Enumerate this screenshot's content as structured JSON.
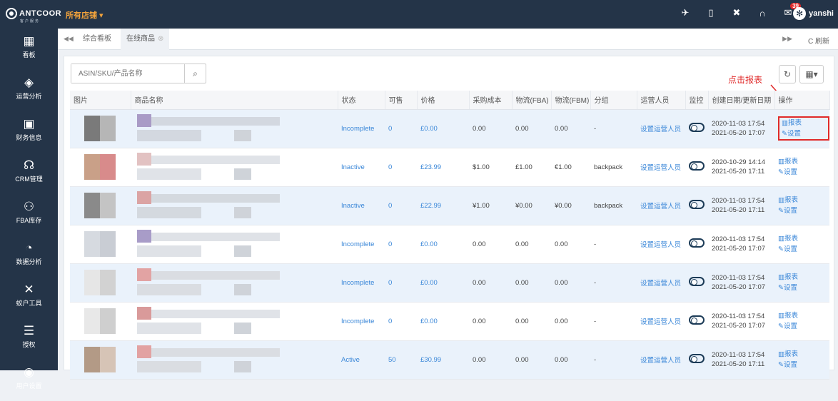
{
  "brand": {
    "name": "ANTCOOR",
    "sub": "客户服务"
  },
  "store_selector": "所有店铺 ▾",
  "user": {
    "name": "yanshi",
    "mail_count": "39"
  },
  "top_icons": [
    "rocket-icon",
    "phone-icon",
    "fullscreen-icon",
    "headset-icon",
    "mail-icon"
  ],
  "sidebar": {
    "items": [
      {
        "label": "看板",
        "icon": "▦",
        "name": "dashboard-icon"
      },
      {
        "label": "运营分析",
        "icon": "◈",
        "name": "analysis-icon"
      },
      {
        "label": "财务信息",
        "icon": "▣",
        "name": "finance-icon"
      },
      {
        "label": "CRM管理",
        "icon": "☊",
        "name": "crm-icon"
      },
      {
        "label": "FBA库存",
        "icon": "⚇",
        "name": "inventory-icon"
      },
      {
        "label": "数据分析",
        "icon": "◔",
        "name": "data-icon"
      },
      {
        "label": "蚁户工具",
        "icon": "✕",
        "name": "tools-icon"
      },
      {
        "label": "授权",
        "icon": "☰",
        "name": "auth-icon"
      },
      {
        "label": "用户设置",
        "icon": "◉",
        "name": "user-settings-icon"
      }
    ]
  },
  "tabs": {
    "items": [
      {
        "label": "综合看板"
      },
      {
        "label": "在线商品"
      }
    ],
    "refresh": "C 刷新"
  },
  "search": {
    "placeholder": "ASIN/SKU/产品名称"
  },
  "annotation": "点击报表",
  "table": {
    "headers": [
      "图片",
      "商品名称",
      "状态",
      "可售",
      "价格",
      "采购成本",
      "物流(FBA)",
      "物流(FBM)",
      "分组",
      "运营人员",
      "监控",
      "创建日期/更新日期",
      "操作"
    ],
    "rows": [
      {
        "status": "Incomplete",
        "qty": "0",
        "price": "£0.00",
        "cost": "0.00",
        "fba": "0.00",
        "fbm": "0.00",
        "group": "-",
        "ops": "设置运营人员",
        "created": "2020-11-03 17:54",
        "updated": "2021-05-20 17:07",
        "report": "报表",
        "setting": "设置"
      },
      {
        "status": "Inactive",
        "qty": "0",
        "price": "£23.99",
        "cost": "$1.00",
        "fba": "£1.00",
        "fbm": "€1.00",
        "group": "backpack",
        "ops": "设置运营人员",
        "created": "2020-10-29 14:14",
        "updated": "2021-05-20 17:11",
        "report": "报表",
        "setting": "设置"
      },
      {
        "status": "Inactive",
        "qty": "0",
        "price": "£22.99",
        "cost": "¥1.00",
        "fba": "¥0.00",
        "fbm": "¥0.00",
        "group": "backpack",
        "ops": "设置运营人员",
        "created": "2020-11-03 17:54",
        "updated": "2021-05-20 17:11",
        "report": "报表",
        "setting": "设置"
      },
      {
        "status": "Incomplete",
        "qty": "0",
        "price": "£0.00",
        "cost": "0.00",
        "fba": "0.00",
        "fbm": "0.00",
        "group": "-",
        "ops": "设置运营人员",
        "created": "2020-11-03 17:54",
        "updated": "2021-05-20 17:07",
        "report": "报表",
        "setting": "设置"
      },
      {
        "status": "Incomplete",
        "qty": "0",
        "price": "£0.00",
        "cost": "0.00",
        "fba": "0.00",
        "fbm": "0.00",
        "group": "-",
        "ops": "设置运营人员",
        "created": "2020-11-03 17:54",
        "updated": "2021-05-20 17:07",
        "report": "报表",
        "setting": "设置"
      },
      {
        "status": "Incomplete",
        "qty": "0",
        "price": "£0.00",
        "cost": "0.00",
        "fba": "0.00",
        "fbm": "0.00",
        "group": "-",
        "ops": "设置运营人员",
        "created": "2020-11-03 17:54",
        "updated": "2021-05-20 17:07",
        "report": "报表",
        "setting": "设置"
      },
      {
        "status": "Active",
        "qty": "50",
        "price": "£30.99",
        "cost": "0.00",
        "fba": "0.00",
        "fbm": "0.00",
        "group": "-",
        "ops": "设置运营人员",
        "created": "2020-11-03 17:54",
        "updated": "2021-05-20 17:11",
        "report": "报表",
        "setting": "设置"
      }
    ]
  },
  "colors": {
    "nav": "#243448",
    "accent": "#3a87d8",
    "annotation": "#e02a2a",
    "store": "#f3a33b"
  }
}
